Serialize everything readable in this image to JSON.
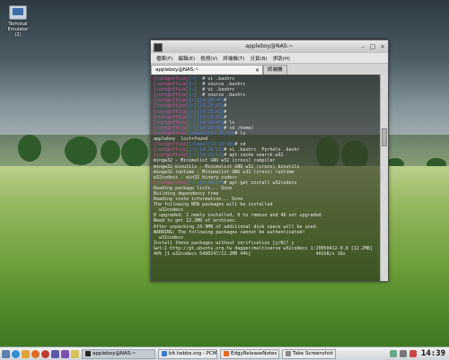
{
  "desktop": {
    "icon_label_line1": "Terminal",
    "icon_label_line2": "Emulator (2)"
  },
  "window": {
    "title": "appleboy@NAS:~",
    "menu": [
      "檔案(F)",
      "編輯(E)",
      "檢視(V)",
      "終端機(T)",
      "分頁(B)",
      "求助(H)"
    ],
    "tabs": [
      {
        "label": "appleboy@NAS:~",
        "active": true
      },
      {
        "label": "終端機",
        "active": false
      }
    ]
  },
  "terminal": {
    "lines": [
      {
        "user": "[root@office]",
        "path": "[~]",
        "cmd": "  # vi .bashrc"
      },
      {
        "user": "[root@office]",
        "path": "[~]",
        "cmd": "  # source .bashrc"
      },
      {
        "user": "[root@office]",
        "path": "[~]",
        "cmd": "  # vi .bashrc"
      },
      {
        "user": "[root@office]",
        "path": "[~]",
        "cmd": "  # source .bashrc"
      },
      {
        "user": "[root@office]",
        "path": "[~][14:28:40]",
        "cmd": "#"
      },
      {
        "user": "[root@office]",
        "path": "[~][14:28:41]",
        "cmd": "#"
      },
      {
        "user": "[root@office]",
        "path": "[~][14:28:42]",
        "cmd": "#"
      },
      {
        "user": "[root@office]",
        "path": "[~][14:28:43]",
        "cmd": "#"
      },
      {
        "user": "[root@office]",
        "path": "[~][14:28:45]",
        "cmd": "# ls"
      },
      {
        "user": "[root@office]",
        "path": "[~][14:28:46]",
        "cmd": "# cd /home/"
      },
      {
        "user": "[root@office]",
        "path": "[/home][14:28:47]",
        "cmd": "# ls"
      },
      {
        "user": "",
        "path": "",
        "cmd": "appleboy  lost+found"
      },
      {
        "user": "[root@office]",
        "path": "[/home][14:28:48]",
        "cmd": "# cd"
      },
      {
        "user": "[root@office]",
        "path": "[~][14:28:55]",
        "cmd": "# vi .bashrc  Pyrhelo .bashr"
      },
      {
        "user": "[root@office]",
        "path": "[~][14:29:15]",
        "cmd": "# apt-cache search w32"
      },
      {
        "user": "",
        "path": "",
        "cmd": "mingw32 - Minimalist GNU w32 (cross) compiler"
      },
      {
        "user": "",
        "path": "",
        "cmd": "mingw32-binutils - Minimalist GNU w32 (cross) binutils"
      },
      {
        "user": "",
        "path": "",
        "cmd": "mingw32-runtime - Minimalist GNU w32 (cross) runtime"
      },
      {
        "user": "",
        "path": "",
        "cmd": "w32codecs - win32 binary codecs"
      },
      {
        "user": "[root@office]",
        "path": "[~][14:30:07]",
        "cmd": "# apt-get install w32codecs"
      },
      {
        "user": "",
        "path": "",
        "cmd": "Reading package lists... Done"
      },
      {
        "user": "",
        "path": "",
        "cmd": "Building dependency tree"
      },
      {
        "user": "",
        "path": "",
        "cmd": "Reading state information... Done"
      },
      {
        "user": "",
        "path": "",
        "cmd": "The following NEW packages will be installed"
      },
      {
        "user": "",
        "path": "",
        "cmd": "  w32codecs"
      },
      {
        "user": "",
        "path": "",
        "cmd": "0 upgraded, 1 newly installed, 0 to remove and 46 not upgraded."
      },
      {
        "user": "",
        "path": "",
        "cmd": "Need to get 12.2MB of archives."
      },
      {
        "user": "",
        "path": "",
        "cmd": "After unpacking 24.9MB of additional disk space will be used."
      },
      {
        "user": "",
        "path": "",
        "cmd": "WARNING: The following packages cannot be authenticated!"
      },
      {
        "user": "",
        "path": "",
        "cmd": "  w32codecs"
      },
      {
        "user": "",
        "path": "",
        "cmd": "Install these packages without verification [y/N]? y"
      },
      {
        "user": "",
        "path": "",
        "cmd": "Get:1 http://gt.ubuntu.org.tw dapper/multiverse w32codecs 1:20050412-0.8 [12.2MB]"
      },
      {
        "user": "",
        "path": "",
        "cmd": "40% [1 w32codecs 5480247/12.2MB 44%]                        402kB/s 16s"
      }
    ]
  },
  "taskbar": {
    "tasks": [
      {
        "label": "appleboy@NAS:~",
        "active": true
      },
      {
        "label": "bit.twbbs.org - PCMa",
        "active": false
      },
      {
        "label": "EdgyReleaseNotes - ...",
        "active": false
      },
      {
        "label": "Take Screenshot",
        "active": false
      }
    ],
    "clock": "14:39"
  },
  "colors": {
    "prompt_user": "#d24aa0",
    "prompt_path": "#4a7ad8",
    "term_text": "#e8e8e8"
  }
}
